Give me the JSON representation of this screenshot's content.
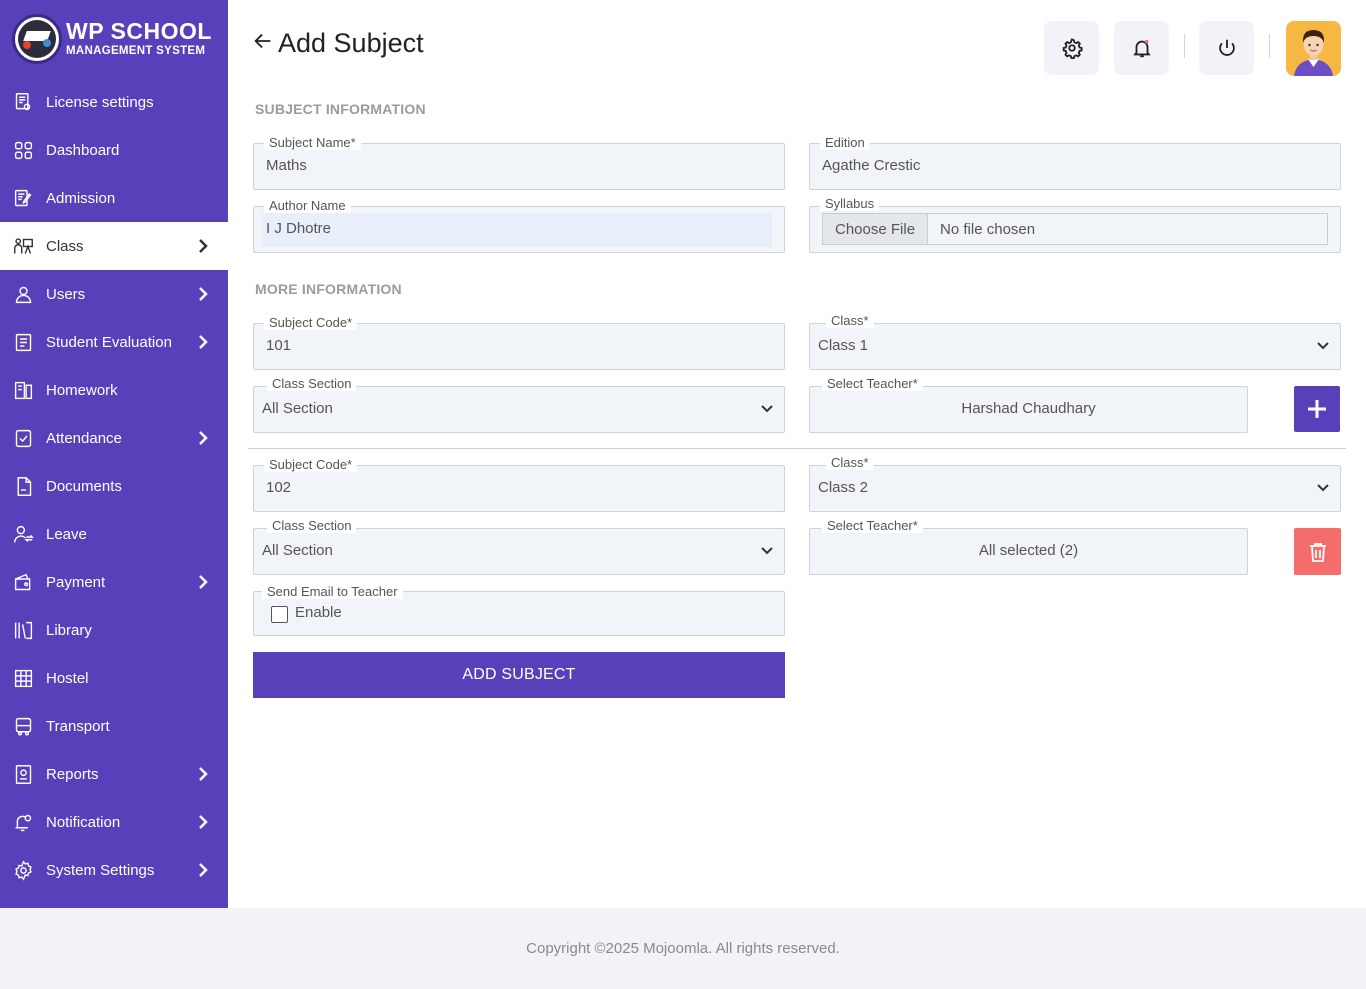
{
  "brand": {
    "title": "WP SCHOOL",
    "subtitle": "MANAGEMENT SYSTEM"
  },
  "sidebar": {
    "items": [
      {
        "label": "License settings",
        "icon": "license-icon",
        "has_submenu": false,
        "active": false
      },
      {
        "label": "Dashboard",
        "icon": "dashboard-grid-icon",
        "has_submenu": false,
        "active": false
      },
      {
        "label": "Admission",
        "icon": "admission-icon",
        "has_submenu": false,
        "active": false
      },
      {
        "label": "Class",
        "icon": "class-icon",
        "has_submenu": true,
        "active": true
      },
      {
        "label": "Users",
        "icon": "user-icon",
        "has_submenu": true,
        "active": false
      },
      {
        "label": "Student Evaluation",
        "icon": "evaluation-icon",
        "has_submenu": true,
        "active": false
      },
      {
        "label": "Homework",
        "icon": "homework-icon",
        "has_submenu": false,
        "active": false
      },
      {
        "label": "Attendance",
        "icon": "attendance-icon",
        "has_submenu": true,
        "active": false
      },
      {
        "label": "Documents",
        "icon": "document-icon",
        "has_submenu": false,
        "active": false
      },
      {
        "label": "Leave",
        "icon": "leave-icon",
        "has_submenu": false,
        "active": false
      },
      {
        "label": "Payment",
        "icon": "wallet-icon",
        "has_submenu": true,
        "active": false
      },
      {
        "label": "Library",
        "icon": "library-icon",
        "has_submenu": false,
        "active": false
      },
      {
        "label": "Hostel",
        "icon": "hostel-icon",
        "has_submenu": false,
        "active": false
      },
      {
        "label": "Transport",
        "icon": "bus-icon",
        "has_submenu": false,
        "active": false
      },
      {
        "label": "Reports",
        "icon": "report-icon",
        "has_submenu": true,
        "active": false
      },
      {
        "label": "Notification",
        "icon": "notification-icon",
        "has_submenu": true,
        "active": false
      },
      {
        "label": "System Settings",
        "icon": "settings-icon",
        "has_submenu": true,
        "active": false
      }
    ]
  },
  "header": {
    "title": "Add Subject",
    "buttons": [
      "gear-icon",
      "bell-icon",
      "power-icon"
    ]
  },
  "subject_info": {
    "section_title": "SUBJECT INFORMATION",
    "subject_name": {
      "label": "Subject Name*",
      "value": "Maths"
    },
    "edition": {
      "label": "Edition",
      "value": "Agathe Crestic"
    },
    "author_name": {
      "label": "Author Name",
      "value": "I J Dhotre"
    },
    "syllabus": {
      "label": "Syllabus",
      "button": "Choose File",
      "file": "No file chosen"
    }
  },
  "more_info": {
    "section_title": "MORE INFORMATION",
    "rows": [
      {
        "subject_code": {
          "label": "Subject Code*",
          "value": "101"
        },
        "class": {
          "label": "Class*",
          "value": "Class 1"
        },
        "class_section": {
          "label": "Class Section",
          "value": "All Section"
        },
        "teacher": {
          "label": "Select Teacher*",
          "value": "Harshad Chaudhary"
        }
      },
      {
        "subject_code": {
          "label": "Subject Code*",
          "value": "102"
        },
        "class": {
          "label": "Class*",
          "value": "Class 2"
        },
        "class_section": {
          "label": "Class Section",
          "value": "All Section"
        },
        "teacher": {
          "label": "Select Teacher*",
          "value": "All selected (2)"
        }
      }
    ],
    "send_email": {
      "label": "Send Email to Teacher",
      "checkbox_label": "Enable",
      "checked": false
    }
  },
  "submit_label": "ADD SUBJECT",
  "footer": {
    "text": "Copyright ©2025 Mojoomla. All rights reserved."
  },
  "colors": {
    "primary": "#5840bb",
    "danger": "#f46d6a",
    "field_bg": "#f1f4f9",
    "avatar_bg": "#f7b843"
  }
}
